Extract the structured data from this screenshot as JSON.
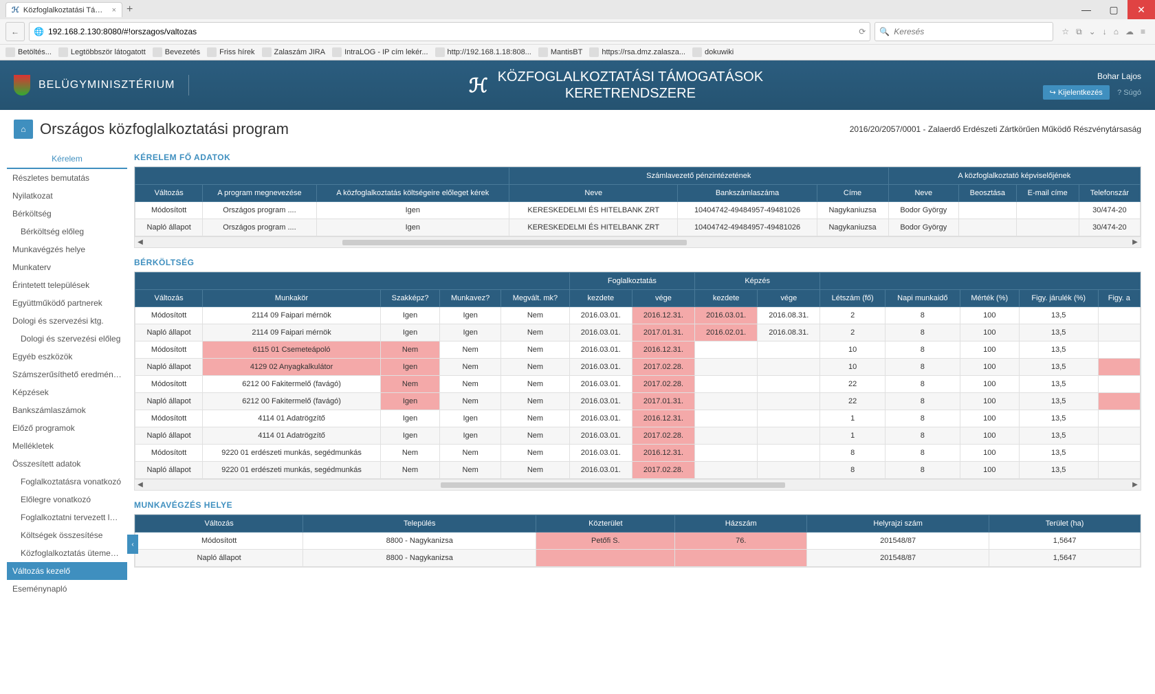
{
  "browser": {
    "tab_title": "Közfoglalkoztatási Támog...",
    "url": "192.168.2.130:8080/#!orszagos/valtozas",
    "search_placeholder": "Keresés",
    "bookmarks": [
      "Betöltés...",
      "Legtöbbször látogatott",
      "Bevezetés",
      "Friss hírek",
      "Zalaszám JIRA",
      "IntraLOG - IP cím lekér...",
      "http://192.168.1.18:808...",
      "MantisBT",
      "https://rsa.dmz.zalasza...",
      "dokuwiki"
    ]
  },
  "header": {
    "ministry": "BELÜGYMINISZTÉRIUM",
    "app_title_line1": "KÖZFOGLALKOZTATÁSI TÁMOGATÁSOK",
    "app_title_line2": "KERETRENDSZERE",
    "user": "Bohar Lajos",
    "logout": "Kijelentkezés",
    "help": "? Súgó"
  },
  "page": {
    "title": "Országos közfoglalkoztatási program",
    "info": "2016/20/2057/0001 - Zalaerdő Erdészeti Zártkörűen Működő Részvénytársaság"
  },
  "sidebar": {
    "header": "Kérelem",
    "items": [
      {
        "label": "Részletes bemutatás"
      },
      {
        "label": "Nyilatkozat"
      },
      {
        "label": "Bérköltség"
      },
      {
        "label": "Bérköltség előleg",
        "indent": true
      },
      {
        "label": "Munkavégzés helye"
      },
      {
        "label": "Munkaterv"
      },
      {
        "label": "Érintetett települések"
      },
      {
        "label": "Együttműködő partnerek"
      },
      {
        "label": "Dologi és szervezési ktg."
      },
      {
        "label": "Dologi és szervezési előleg",
        "indent": true
      },
      {
        "label": "Egyéb eszközök"
      },
      {
        "label": "Számszerűsíthető eredmény..."
      },
      {
        "label": "Képzések"
      },
      {
        "label": "Bankszámlaszámok"
      },
      {
        "label": "Előző programok"
      },
      {
        "label": "Mellékletek"
      },
      {
        "label": "Összesített adatok"
      },
      {
        "label": "Foglalkoztatásra vonatkozó",
        "indent": true
      },
      {
        "label": "Előlegre vonatkozó",
        "indent": true
      },
      {
        "label": "Foglalkoztatni tervezett léts...",
        "indent": true
      },
      {
        "label": "Költségek összesítése",
        "indent": true
      },
      {
        "label": "Közfoglalkoztatás ütemezé...",
        "indent": true
      },
      {
        "label": "Változás kezelő",
        "active": true
      },
      {
        "label": "Eseménynapló"
      }
    ]
  },
  "section1": {
    "title": "KÉRELEM FŐ ADATOK",
    "group_headers": [
      "",
      "",
      "",
      "Számlavezető pénzintézetének",
      "A közfoglalkoztató képviselőjének"
    ],
    "columns": [
      "Változás",
      "A program megnevezése",
      "A közfoglalkoztatás költségeire előleget kérek",
      "Neve",
      "Bankszámlaszáma",
      "Címe",
      "Neve",
      "Beosztása",
      "E-mail címe",
      "Telefonszár"
    ],
    "rows": [
      {
        "c": [
          "Módosított",
          "Országos program ....",
          "Igen",
          "KERESKEDELMI ÉS HITELBANK ZRT",
          "10404742-49484957-49481026",
          "Nagykaniuzsa",
          "Bodor György",
          "",
          "",
          "30/474-20"
        ]
      },
      {
        "c": [
          "Napló állapot",
          "Országos program ....",
          "Igen",
          "KERESKEDELMI ÉS HITELBANK ZRT",
          "10404742-49484957-49481026",
          "Nagykaniuzsa",
          "Bodor György",
          "",
          "",
          "30/474-20"
        ]
      }
    ]
  },
  "section2": {
    "title": "BÉRKÖLTSÉG",
    "group_headers": [
      "",
      "",
      "",
      "",
      "",
      "Foglalkoztatás",
      "Képzés",
      "",
      "",
      "",
      "",
      ""
    ],
    "columns": [
      "Változás",
      "Munkakör",
      "Szakképz?",
      "Munkavez?",
      "Megvált. mk?",
      "kezdete",
      "vége",
      "kezdete",
      "vége",
      "Létszám (fő)",
      "Napi munkaidő",
      "Mérték (%)",
      "Figy. járulék (%)",
      "Figy. a"
    ],
    "rows": [
      {
        "c": [
          "Módosított",
          "2114 09 Faipari mérnök",
          "Igen",
          "Igen",
          "Nem",
          "2016.03.01.",
          "2016.12.31.",
          "2016.03.01.",
          "2016.08.31.",
          "2",
          "8",
          "100",
          "13,5",
          ""
        ],
        "ch": [
          6,
          7
        ]
      },
      {
        "c": [
          "Napló állapot",
          "2114 09 Faipari mérnök",
          "Igen",
          "Igen",
          "Nem",
          "2016.03.01.",
          "2017.01.31.",
          "2016.02.01.",
          "2016.08.31.",
          "2",
          "8",
          "100",
          "13,5",
          ""
        ],
        "ch": [
          6,
          7
        ]
      },
      {
        "c": [
          "Módosított",
          "6115 01 Csemeteápoló",
          "Nem",
          "Nem",
          "Nem",
          "2016.03.01.",
          "2016.12.31.",
          "",
          "",
          "10",
          "8",
          "100",
          "13,5",
          ""
        ],
        "ch": [
          1,
          2,
          6
        ]
      },
      {
        "c": [
          "Napló állapot",
          "4129 02 Anyagkalkulátor",
          "Igen",
          "Nem",
          "Nem",
          "2016.03.01.",
          "2017.02.28.",
          "",
          "",
          "10",
          "8",
          "100",
          "13,5",
          ""
        ],
        "ch": [
          1,
          2,
          6,
          13
        ]
      },
      {
        "c": [
          "Módosított",
          "6212 00 Fakitermelő (favágó)",
          "Nem",
          "Nem",
          "Nem",
          "2016.03.01.",
          "2017.02.28.",
          "",
          "",
          "22",
          "8",
          "100",
          "13,5",
          ""
        ],
        "ch": [
          2,
          6
        ]
      },
      {
        "c": [
          "Napló állapot",
          "6212 00 Fakitermelő (favágó)",
          "Igen",
          "Nem",
          "Nem",
          "2016.03.01.",
          "2017.01.31.",
          "",
          "",
          "22",
          "8",
          "100",
          "13,5",
          ""
        ],
        "ch": [
          2,
          6,
          13
        ]
      },
      {
        "c": [
          "Módosított",
          "4114 01 Adatrögzítő",
          "Igen",
          "Igen",
          "Nem",
          "2016.03.01.",
          "2016.12.31.",
          "",
          "",
          "1",
          "8",
          "100",
          "13,5",
          ""
        ],
        "ch": [
          6
        ]
      },
      {
        "c": [
          "Napló állapot",
          "4114 01 Adatrögzítő",
          "Igen",
          "Igen",
          "Nem",
          "2016.03.01.",
          "2017.02.28.",
          "",
          "",
          "1",
          "8",
          "100",
          "13,5",
          ""
        ],
        "ch": [
          6
        ]
      },
      {
        "c": [
          "Módosított",
          "9220 01 erdészeti munkás, segédmunkás",
          "Nem",
          "Nem",
          "Nem",
          "2016.03.01.",
          "2016.12.31.",
          "",
          "",
          "8",
          "8",
          "100",
          "13,5",
          ""
        ],
        "ch": [
          6
        ]
      },
      {
        "c": [
          "Napló állapot",
          "9220 01 erdészeti munkás, segédmunkás",
          "Nem",
          "Nem",
          "Nem",
          "2016.03.01.",
          "2017.02.28.",
          "",
          "",
          "8",
          "8",
          "100",
          "13,5",
          ""
        ],
        "ch": [
          6
        ]
      }
    ]
  },
  "section3": {
    "title": "MUNKAVÉGZÉS HELYE",
    "columns": [
      "Változás",
      "Település",
      "Közterület",
      "Házszám",
      "Helyrajzi szám",
      "Terület (ha)"
    ],
    "rows": [
      {
        "c": [
          "Módosított",
          "8800 - Nagykanizsa",
          "Petőfi S.",
          "76.",
          "201548/87",
          "1,5647"
        ],
        "ch": [
          2,
          3
        ]
      },
      {
        "c": [
          "Napló állapot",
          "8800 - Nagykanizsa",
          "",
          "",
          "201548/87",
          "1,5647"
        ],
        "ch": [
          2,
          3
        ]
      }
    ]
  }
}
